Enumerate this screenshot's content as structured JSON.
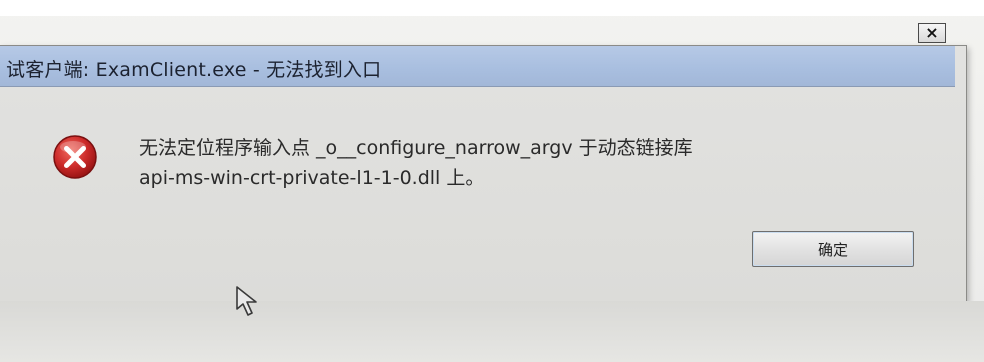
{
  "dialog": {
    "title": "试客户端: ExamClient.exe - 无法找到入口",
    "close_label": "×",
    "message_line1": "无法定位程序输入点 _o__configure_narrow_argv 于动态链接库",
    "message_line2": "api-ms-win-crt-private-l1-1-0.dll 上。",
    "ok_label": "确定",
    "icon": "error-icon"
  },
  "colors": {
    "titlebar": "#a8bedf",
    "error_red": "#c8242a",
    "dialog_bg": "#dedede"
  }
}
